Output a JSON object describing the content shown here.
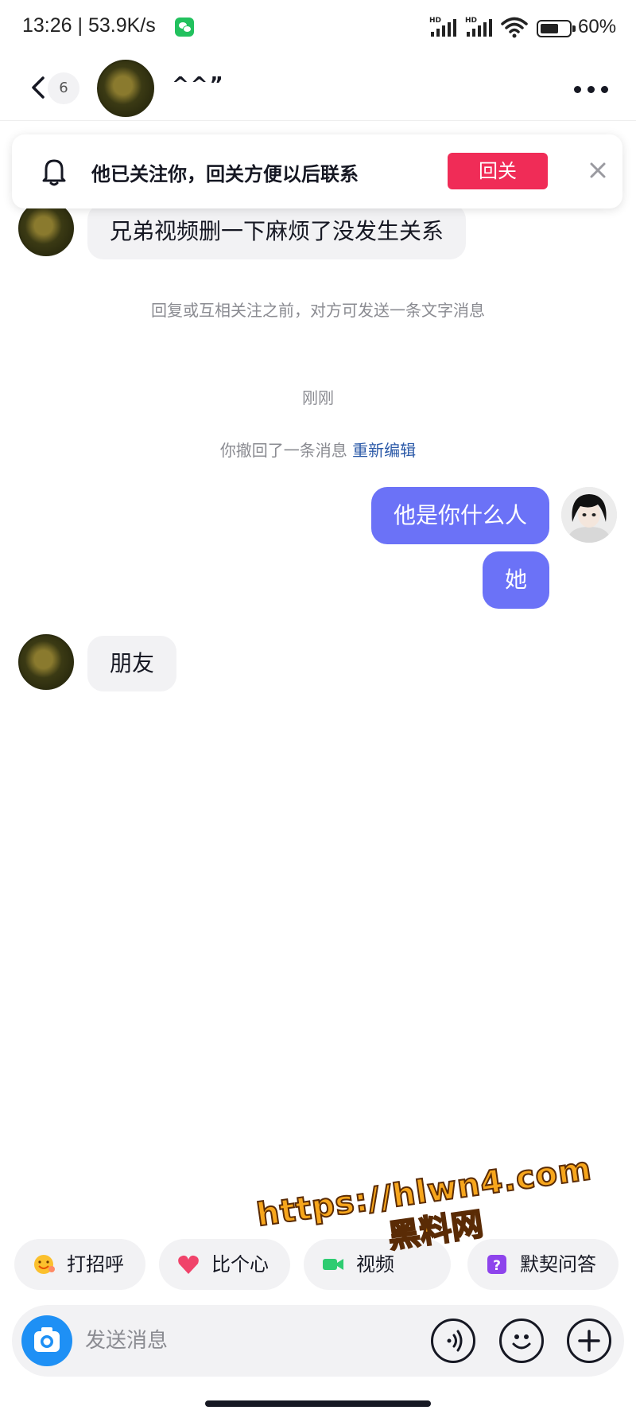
{
  "status_bar": {
    "time": "13:26 | 53.9K/s",
    "battery": "60%",
    "network_label": "HD"
  },
  "header": {
    "unread_count": "6",
    "contact_name": "^^”"
  },
  "follow_banner": {
    "text": "他已关注你，回关方便以后联系",
    "button_label": "回关"
  },
  "messages": {
    "first_incoming": "兄弟视频删一下麻烦了没发生关系",
    "notice": "回复或互相关注之前，对方可发送一条文字消息",
    "timestamp": "刚刚",
    "recall_text": "你撤回了一条消息",
    "recall_edit": "重新编辑",
    "outgoing_1": "他是你什么人",
    "outgoing_2": "她",
    "last_incoming": "朋友"
  },
  "quick_chips": [
    {
      "label": "打招呼",
      "icon": "smiley-face-icon"
    },
    {
      "label": "比个心",
      "icon": "heart-icon"
    },
    {
      "label": "视频",
      "icon": "video-icon"
    },
    {
      "label": "默契问答",
      "icon": "question-icon"
    }
  ],
  "input_bar": {
    "placeholder": "发送消息"
  },
  "watermark": {
    "url": "https://hlwn4.com",
    "name": "黑料网"
  },
  "colors": {
    "accent_red": "#f02c57",
    "outgoing_bubble": "#6b72f7",
    "camera_blue": "#1e90f5",
    "bubble_gray": "#f2f2f4"
  }
}
